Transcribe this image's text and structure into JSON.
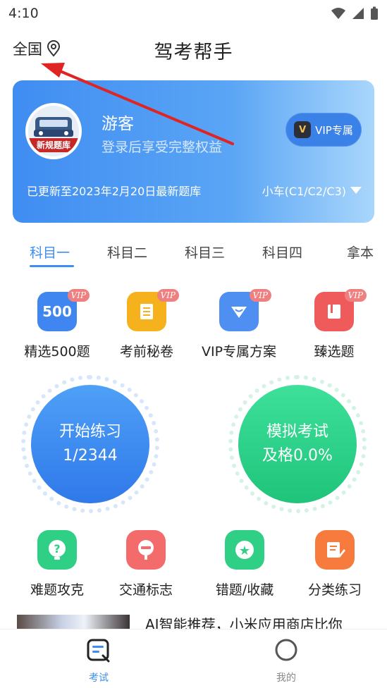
{
  "status_bar": {
    "time": "4:10"
  },
  "header": {
    "location": "全国",
    "title": "驾考帮手"
  },
  "profile": {
    "name": "游客",
    "subtitle": "登录后享受完整权益",
    "vip_button": "VIP专属",
    "vip_badge": "V",
    "avatar_banner": "新规题库",
    "update_text": "已更新至2023年2月20日最新题库",
    "car_type": "小车(C1/C2/C3)"
  },
  "tabs": [
    "科目一",
    "科目二",
    "科目三",
    "科目四",
    "拿本"
  ],
  "features": [
    {
      "label": "精选500题",
      "icon_text": "500",
      "tag": "VIP",
      "color": "#3f86f0"
    },
    {
      "label": "考前秘卷",
      "tag": "VIP",
      "color": "#f6b21d"
    },
    {
      "label": "VIP专属方案",
      "tag": "VIP",
      "color": "#4f8ff2"
    },
    {
      "label": "臻选题",
      "tag": "VIP",
      "color": "#ef5b5b"
    }
  ],
  "practice": {
    "title": "开始练习",
    "progress": "1/2344"
  },
  "exam": {
    "title": "模拟考试",
    "pass_rate": "及格0.0%"
  },
  "quick_actions": [
    {
      "label": "难题攻克",
      "icon": "?",
      "color": "#2fcf85"
    },
    {
      "label": "交通标志",
      "color": "#f36b6b"
    },
    {
      "label": "错题/收藏",
      "icon": "★",
      "color": "#2fcf85"
    },
    {
      "label": "分类练习",
      "color": "#f77b3c"
    }
  ],
  "news": {
    "headline": "AI智能推荐，小米应用商店比你"
  },
  "bottom_nav": [
    {
      "label": "考试",
      "active": true
    },
    {
      "label": "我的",
      "active": false
    }
  ],
  "colors": {
    "primary": "#3d8ef0",
    "annotation_arrow": "#e02424"
  }
}
